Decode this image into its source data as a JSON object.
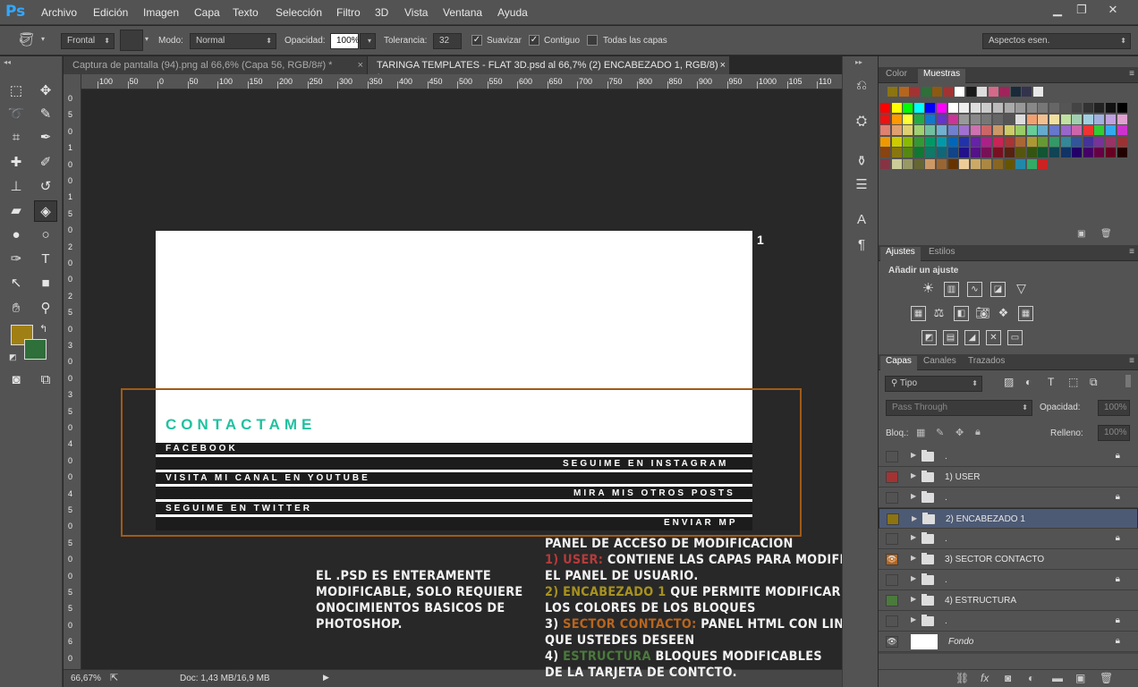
{
  "app": {
    "logo": "Ps"
  },
  "menu": [
    "Archivo",
    "Edición",
    "Imagen",
    "Capa",
    "Texto",
    "Selección",
    "Filtro",
    "3D",
    "Vista",
    "Ventana",
    "Ayuda"
  ],
  "options": {
    "source_select": "Frontal",
    "mode_label": "Modo:",
    "mode_value": "Normal",
    "opacity_label": "Opacidad:",
    "opacity_value": "100%",
    "tolerance_label": "Tolerancia:",
    "tolerance_value": "32",
    "smooth_label": "Suavizar",
    "contiguous_label": "Contiguo",
    "all_layers_label": "Todas las capas",
    "workspace": "Aspectos esen."
  },
  "tabs": [
    {
      "label": "Captura de pantalla (94).png al 66,6% (Capa 56, RGB/8#) *",
      "close": "×"
    },
    {
      "label": "TARINGA TEMPLATES - FLAT 3D.psd al 66,7% (2) ENCABEZADO 1, RGB/8) *",
      "close": "×"
    }
  ],
  "ruler": {
    "h": [
      "100",
      "50",
      "0",
      "50",
      "100",
      "150",
      "200",
      "250",
      "300",
      "350",
      "400",
      "450",
      "500",
      "550",
      "600",
      "650",
      "700",
      "750",
      "800",
      "850",
      "900",
      "950",
      "1000",
      "105",
      "110"
    ],
    "v": [
      "0",
      "5",
      "0",
      "1",
      "0",
      "0",
      "1",
      "5",
      "0",
      "2",
      "0",
      "0",
      "2",
      "5",
      "0",
      "3",
      "0",
      "0",
      "3",
      "5",
      "0",
      "4",
      "0",
      "0",
      "4",
      "5",
      "0",
      "5",
      "0",
      "0",
      "5",
      "5",
      "0",
      "6",
      "0"
    ]
  },
  "status": {
    "zoom": "66,67%",
    "doc": "Doc: 1,43 MB/16,9 MB"
  },
  "canvas": {
    "page_number": "1",
    "contact_title": "CONTACTAME",
    "links": [
      "FACEBOOK",
      "SEGUIME EN INSTAGRAM",
      "VISITA MI CANAL EN YOUTUBE",
      "MIRA MIS OTROS POSTS",
      "SEGUIME EN TWITTER",
      "ENVIAR MP"
    ]
  },
  "annotations": {
    "left": [
      "EL .PSD ES ENTERAMENTE",
      "MODIFICABLE, SOLO REQUIERE",
      "ONOCIMIENTOS BASICOS DE",
      "PHOTOSHOP."
    ],
    "right_title": "PANEL DE ACCESO DE MODIFICACION",
    "r1_key": "1) USER:",
    "r1_text": " CONTIENE LAS CAPAS PARA MODIFICAR",
    "r1_text2": "EL PANEL DE USUARIO.",
    "r2_key": "2) ENCABEZADO 1",
    "r2_text": " QUE PERMITE MODIFICAR",
    "r2_text2": "LOS COLORES DE LOS BLOQUES",
    "r3_pre": "3) ",
    "r3_key": "SECTOR CONTACTO:",
    "r3_text": " PANEL HTML CON LINKS A LAS PAGINAS",
    "r3_text2": "QUE USTEDES DESEEN",
    "r4_pre": "4)  ",
    "r4_key": "ESTRUCTURA",
    "r4_text": " BLOQUES MODIFICABLES",
    "r4_text2": "DE LA TARJETA DE CONTCTO."
  },
  "colors_panel": {
    "tab_color": "Color",
    "tab_swatches": "Muestras"
  },
  "adjust_panel": {
    "tab_adjust": "Ajustes",
    "tab_styles": "Estilos",
    "heading": "Añadir un ajuste"
  },
  "layers_panel": {
    "tab_layers": "Capas",
    "tab_channels": "Canales",
    "tab_paths": "Trazados",
    "filter": "Tipo",
    "blend": "Pass Through",
    "opacity_label": "Opacidad:",
    "opacity_value": "100%",
    "lock_label": "Bloq.:",
    "fill_label": "Relleno:",
    "fill_value": "100%",
    "layers": [
      {
        "name": ".",
        "color": "#535353",
        "locked": true
      },
      {
        "name": "1) USER",
        "color": "#a33333",
        "locked": false
      },
      {
        "name": ".",
        "color": "#535353",
        "locked": true
      },
      {
        "name": "2) ENCABEZADO 1",
        "color": "#8c7410",
        "locked": false,
        "selected": true
      },
      {
        "name": ".",
        "color": "#535353",
        "locked": true
      },
      {
        "name": "3) SECTOR CONTACTO",
        "color": "#b5651d",
        "locked": false,
        "eye": true
      },
      {
        "name": ".",
        "color": "#535353",
        "locked": true
      },
      {
        "name": "4) ESTRUCTURA",
        "color": "#4a7a3c",
        "locked": false
      },
      {
        "name": ".",
        "color": "#535353",
        "locked": true
      },
      {
        "name": "Fondo",
        "color": "#535353",
        "locked": true,
        "eye": true,
        "bg": true
      }
    ]
  }
}
